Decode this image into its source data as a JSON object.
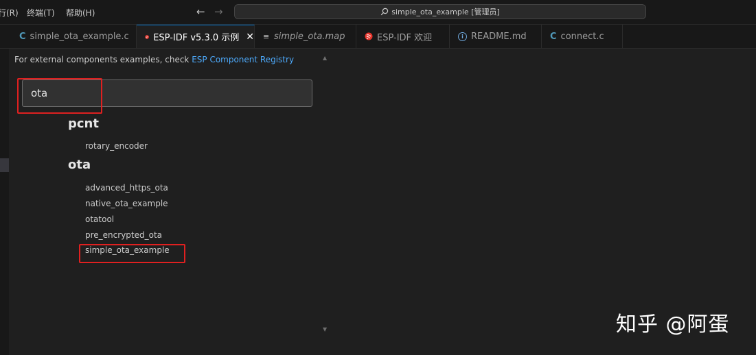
{
  "menu": {
    "run": "行(R)",
    "terminal": "终端(T)",
    "help": "帮助(H)"
  },
  "command_center": {
    "title": "simple_ota_example [管理员]"
  },
  "tabs": [
    {
      "label": "simple_ota_example.c",
      "icon": "c-file-icon"
    },
    {
      "label": "ESP-IDF v5.3.0 示例",
      "icon": "esp-idf-icon",
      "active": true
    },
    {
      "label": "simple_ota.map",
      "icon": "lines-file-icon"
    },
    {
      "label": "ESP-IDF 欢迎",
      "icon": "esp-idf-icon"
    },
    {
      "label": "README.md",
      "icon": "info-icon"
    },
    {
      "label": "connect.c",
      "icon": "c-file-icon"
    }
  ],
  "icons": {
    "c_glyph": "C",
    "close": "✕",
    "lines": "≡",
    "info": "i",
    "back": "←",
    "forward": "→"
  },
  "hint": {
    "text": "For external components examples, check ",
    "link": "ESP Component Registry"
  },
  "search": {
    "value": "ota"
  },
  "groups": [
    {
      "title": "pcnt",
      "items": [
        "rotary_encoder"
      ]
    },
    {
      "title": "ota",
      "items": [
        "advanced_https_ota",
        "native_ota_example",
        "otatool",
        "pre_encrypted_ota",
        "simple_ota_example"
      ]
    }
  ],
  "watermark": "知乎 @阿蛋",
  "colors": {
    "accent": "#0078d4",
    "link": "#4daafc",
    "highlight": "#e02020",
    "background": "#1f1f1f"
  }
}
